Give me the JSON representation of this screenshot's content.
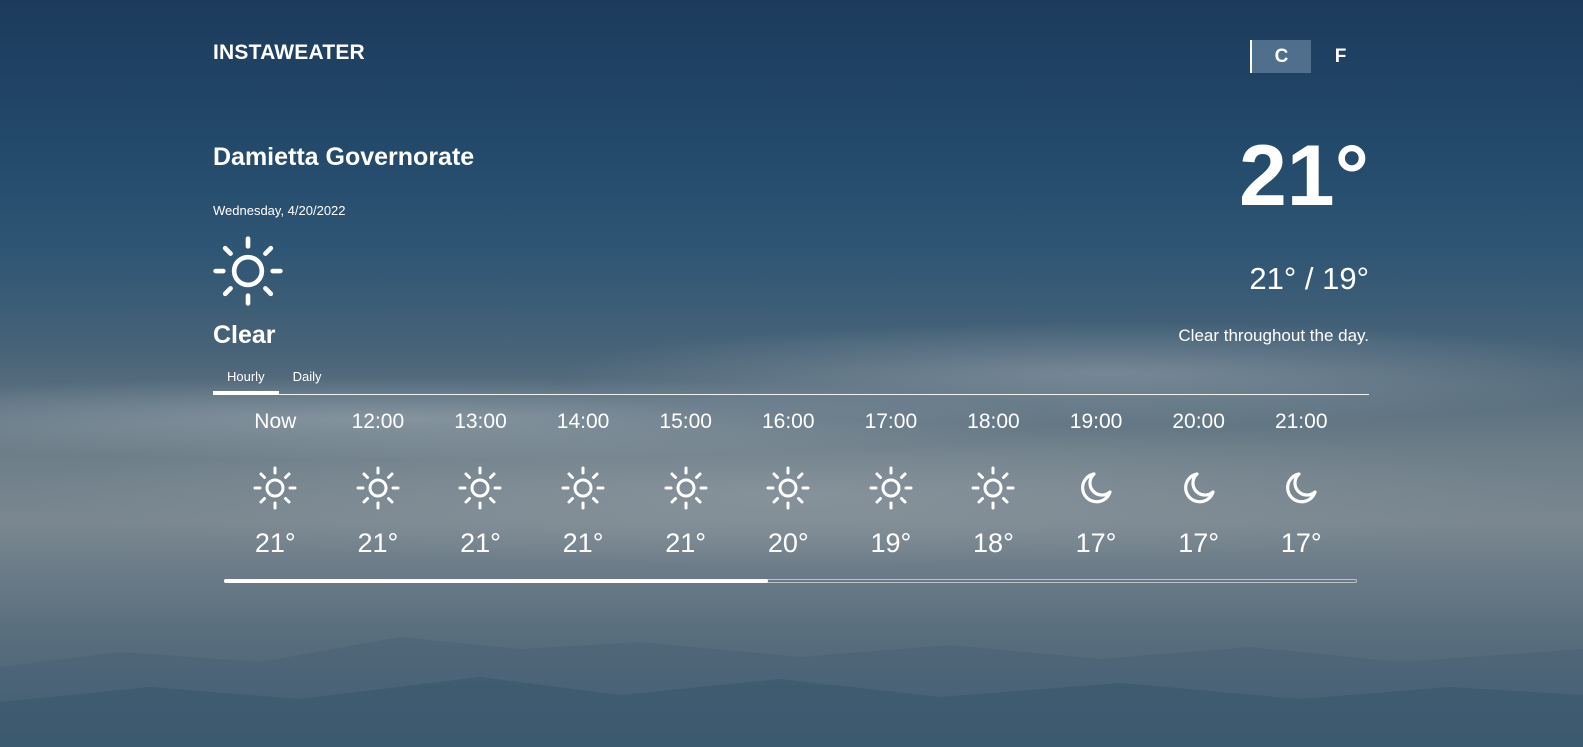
{
  "app": {
    "title": "INSTAWEATER"
  },
  "units": {
    "options": [
      {
        "label": "C",
        "active": true
      },
      {
        "label": "F",
        "active": false
      }
    ]
  },
  "location": {
    "name": "Damietta Governorate",
    "date": "Wednesday, 4/20/2022"
  },
  "current": {
    "icon": "sun-icon",
    "condition": "Clear",
    "temperature": "21°",
    "high_low": "21° / 19°",
    "summary": "Clear throughout the day."
  },
  "tabs": [
    {
      "label": "Hourly",
      "active": true
    },
    {
      "label": "Daily",
      "active": false
    }
  ],
  "hourly": [
    {
      "time": "Now",
      "icon": "sun-icon",
      "temp": "21°"
    },
    {
      "time": "12:00",
      "icon": "sun-icon",
      "temp": "21°"
    },
    {
      "time": "13:00",
      "icon": "sun-icon",
      "temp": "21°"
    },
    {
      "time": "14:00",
      "icon": "sun-icon",
      "temp": "21°"
    },
    {
      "time": "15:00",
      "icon": "sun-icon",
      "temp": "21°"
    },
    {
      "time": "16:00",
      "icon": "sun-icon",
      "temp": "20°"
    },
    {
      "time": "17:00",
      "icon": "sun-icon",
      "temp": "19°"
    },
    {
      "time": "18:00",
      "icon": "sun-icon",
      "temp": "18°"
    },
    {
      "time": "19:00",
      "icon": "moon-icon",
      "temp": "17°"
    },
    {
      "time": "20:00",
      "icon": "moon-icon",
      "temp": "17°"
    },
    {
      "time": "21:00",
      "icon": "moon-icon",
      "temp": "17°"
    }
  ],
  "scroll": {
    "visible_fraction": 0.48
  },
  "colors": {
    "text": "#ffffff",
    "sky_top": "#1c3b5c",
    "sky_mid": "#6c7d88"
  }
}
